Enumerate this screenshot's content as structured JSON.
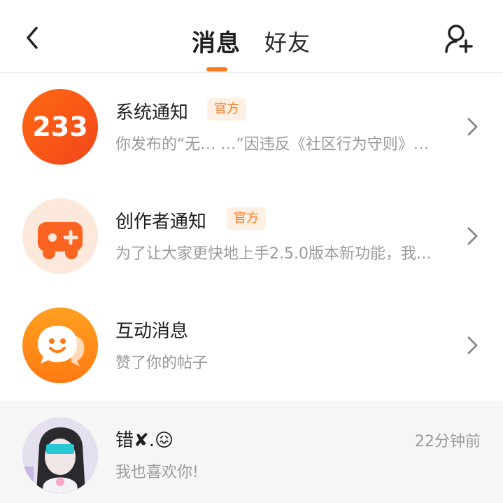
{
  "header": {
    "tab_messages": "消息",
    "tab_friends": "好友"
  },
  "accent_color": "#ff7a1f",
  "messages": [
    {
      "avatar_text": "233",
      "title": "系统通知",
      "badge": "官方",
      "preview": "你发布的“无…  …”因违反《社区行为守则》…",
      "icon": "logo-233"
    },
    {
      "title": "创作者通知",
      "badge": "官方",
      "preview": "为了让大家更快地上手2.5.0版本新功能，我…",
      "icon": "gamepad-plus-icon"
    },
    {
      "title": "互动消息",
      "preview": "赞了你的帖子",
      "icon": "smiley-chat-icon"
    },
    {
      "title": "错✘.😖",
      "preview": "我也喜欢你!",
      "time": "22分钟前",
      "icon": "user-avatar"
    }
  ]
}
